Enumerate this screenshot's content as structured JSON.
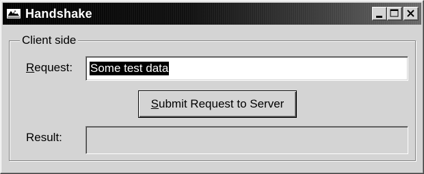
{
  "window": {
    "title": "Handshake",
    "icon": "app-icon",
    "controls": [
      "minimize-icon",
      "maximize-icon",
      "close-icon"
    ]
  },
  "client_group": {
    "legend": "Client side",
    "request": {
      "label_mnemonic": "R",
      "label_rest": "equest:",
      "value": "Some test data"
    },
    "submit": {
      "label_mnemonic": "S",
      "label_rest": "ubmit Request to Server"
    },
    "result": {
      "label": "Result:",
      "value": ""
    }
  },
  "colors": {
    "face": "#d4d4d4",
    "title_start": "#000000",
    "title_end": "#6a6a6a",
    "selection": "#000000"
  }
}
